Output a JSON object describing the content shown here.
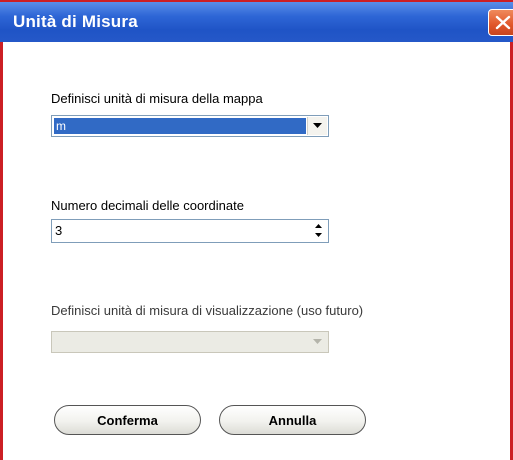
{
  "window": {
    "title": "Unità di Misura",
    "close_icon": "close-icon",
    "accent_color": "#cc1f24",
    "title_color": "#245edb"
  },
  "map_unit": {
    "label": "Definisci unità di misura della mappa",
    "selected": "m"
  },
  "decimals": {
    "label": "Numero decimali delle coordinate",
    "value": "3"
  },
  "display_unit": {
    "label": "Definisci unità di misura di visualizzazione (uso futuro)",
    "selected": "",
    "disabled": true
  },
  "buttons": {
    "confirm": "Conferma",
    "cancel": "Annulla"
  }
}
